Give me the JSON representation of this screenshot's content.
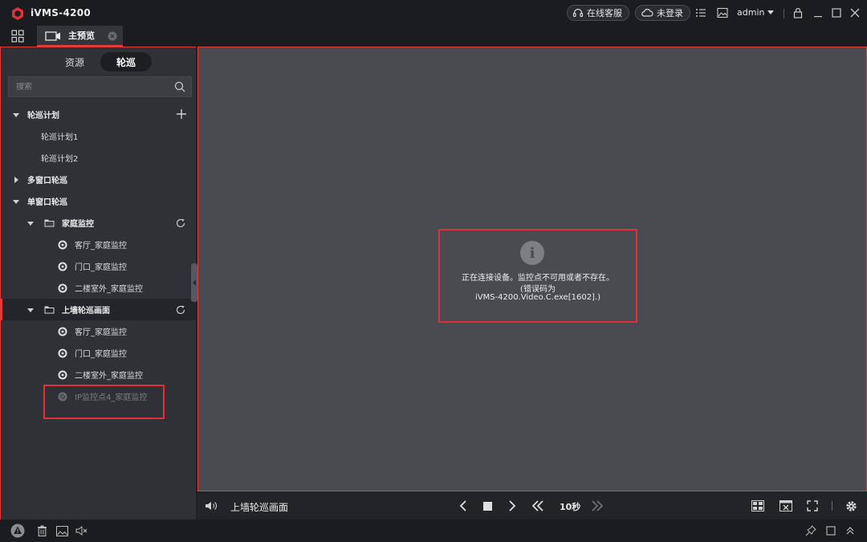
{
  "app": {
    "title": "iVMS-4200",
    "brand_color": "#e0303a"
  },
  "titlebar": {
    "online_service": "在线客服",
    "login_status": "未登录",
    "user": "admin"
  },
  "tabs": [
    {
      "label": "主预览"
    }
  ],
  "sidebar": {
    "segments": [
      {
        "label": "资源"
      },
      {
        "label": "轮巡",
        "active": true
      }
    ],
    "search_placeholder": "搜索",
    "tree": {
      "patrol_plan": {
        "label": "轮巡计划",
        "items": [
          {
            "label": "轮巡计划1"
          },
          {
            "label": "轮巡计划2"
          }
        ]
      },
      "multi_window": {
        "label": "多窗口轮巡"
      },
      "single_window": {
        "label": "单窗口轮巡",
        "groups": [
          {
            "label": "家庭监控",
            "cameras": [
              {
                "label": "客厅_家庭监控"
              },
              {
                "label": "门口_家庭监控"
              },
              {
                "label": "二楼室外_家庭监控"
              }
            ]
          },
          {
            "label": "上墙轮巡画面",
            "cameras": [
              {
                "label": "客厅_家庭监控"
              },
              {
                "label": "门口_家庭监控"
              },
              {
                "label": "二楼室外_家庭监控"
              },
              {
                "label": "IP监控点4_家庭监控",
                "disabled": true
              }
            ]
          }
        ]
      }
    }
  },
  "viewport": {
    "message_line1": "正在连接设备。监控点不可用或者不存在。",
    "message_line2": "(错误码为",
    "message_line3": "iVMS-4200.Video.C.exe[1602].)"
  },
  "toolbar": {
    "title": "上墙轮巡画面",
    "interval": "10秒"
  }
}
